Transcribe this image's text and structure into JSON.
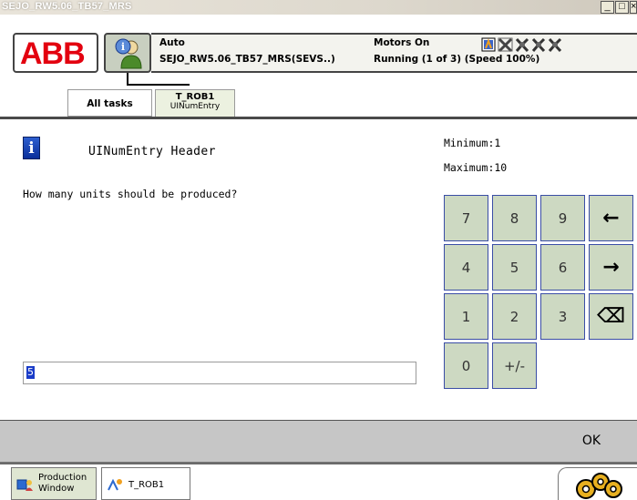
{
  "window": {
    "title": "SEJO_RW5.06_TB57_MRS",
    "btn_min": "_",
    "btn_max": "□",
    "btn_close": "×"
  },
  "header": {
    "logo_text": "ABB",
    "mode": "Auto",
    "system": "SEJO_RW5.06_TB57_MRS(SEVS..)",
    "motors": "Motors On",
    "running": "Running (1 of 3) (Speed 100%)",
    "status_icons": [
      "task-status-icon",
      "task-stopped-icon",
      "mech-unit-icon",
      "mech-unit-icon",
      "mech-unit-icon"
    ]
  },
  "tabs": {
    "all_tasks": "All tasks",
    "task_name": "T_ROB1",
    "task_sub": "UINumEntry"
  },
  "dialog": {
    "header": "UINumEntry Header",
    "minimum": "Minimum:1",
    "maximum": "Maximum:10",
    "question": "How many units should be produced?",
    "value": "5"
  },
  "keypad": {
    "keys": [
      "7",
      "8",
      "9",
      "←",
      "4",
      "5",
      "6",
      "→",
      "1",
      "2",
      "3",
      "⌫",
      "0",
      "+/-"
    ]
  },
  "footer": {
    "ok_label": "OK",
    "prod_label_1": "Production",
    "prod_label_2": "Window",
    "task_label": "T_ROB1"
  },
  "colors": {
    "abb_red": "#e3000f",
    "key_bg": "#cdd9c2",
    "key_border": "#3a4da6",
    "selection": "#1a3cc8"
  }
}
